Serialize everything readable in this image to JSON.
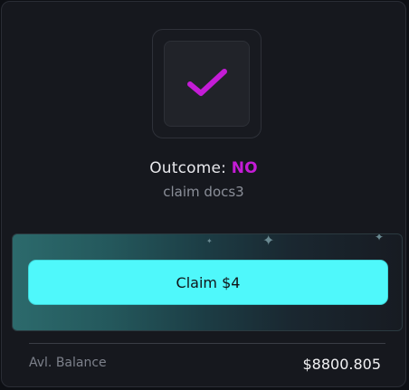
{
  "result": {
    "icon": "checkmark-icon",
    "outcome_label": "Outcome:",
    "outcome_value": "NO",
    "market_name": "claim docs3"
  },
  "claim": {
    "button_label": "Claim $4"
  },
  "balance": {
    "label": "Avl. Balance",
    "value": "$8800.805"
  },
  "colors": {
    "accent_purple": "#c41cd6",
    "claim_button": "#4ff8fb",
    "card_background": "#16181e"
  }
}
